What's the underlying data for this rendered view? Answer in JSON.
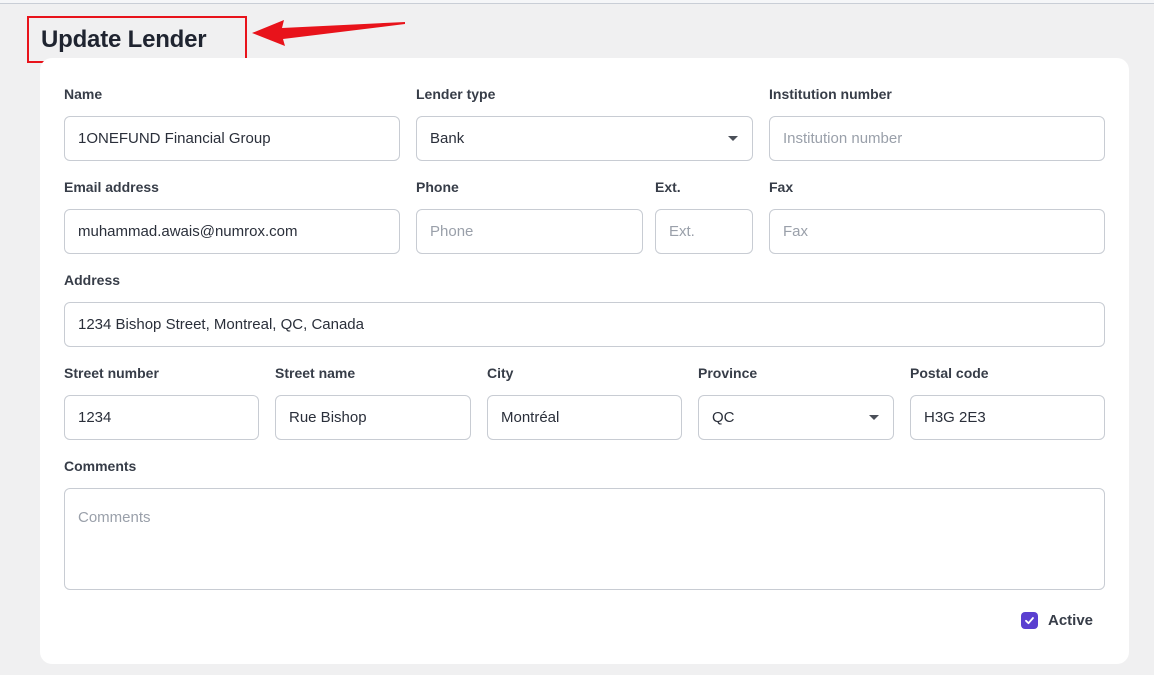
{
  "page": {
    "title": "Update Lender"
  },
  "annotation": {
    "color": "#e8131b",
    "icon": "red-arrow-icon"
  },
  "form": {
    "name": {
      "label": "Name",
      "value": "1ONEFUND Financial Group",
      "placeholder": ""
    },
    "lender_type": {
      "label": "Lender type",
      "value": "Bank"
    },
    "institution_number": {
      "label": "Institution number",
      "value": "",
      "placeholder": "Institution number"
    },
    "email": {
      "label": "Email address",
      "value": "muhammad.awais@numrox.com",
      "placeholder": ""
    },
    "phone": {
      "label": "Phone",
      "value": "",
      "placeholder": "Phone"
    },
    "ext": {
      "label": "Ext.",
      "value": "",
      "placeholder": "Ext."
    },
    "fax": {
      "label": "Fax",
      "value": "",
      "placeholder": "Fax"
    },
    "address": {
      "label": "Address",
      "value": "1234 Bishop Street, Montreal, QC, Canada",
      "placeholder": ""
    },
    "street_number": {
      "label": "Street number",
      "value": "1234",
      "placeholder": ""
    },
    "street_name": {
      "label": "Street name",
      "value": "Rue Bishop",
      "placeholder": ""
    },
    "city": {
      "label": "City",
      "value": "Montréal",
      "placeholder": ""
    },
    "province": {
      "label": "Province",
      "value": "QC"
    },
    "postal_code": {
      "label": "Postal code",
      "value": "H3G 2E3",
      "placeholder": ""
    },
    "comments": {
      "label": "Comments",
      "value": "",
      "placeholder": "Comments"
    },
    "active": {
      "label": "Active",
      "checked": true,
      "color": "#5a3fd0"
    }
  }
}
